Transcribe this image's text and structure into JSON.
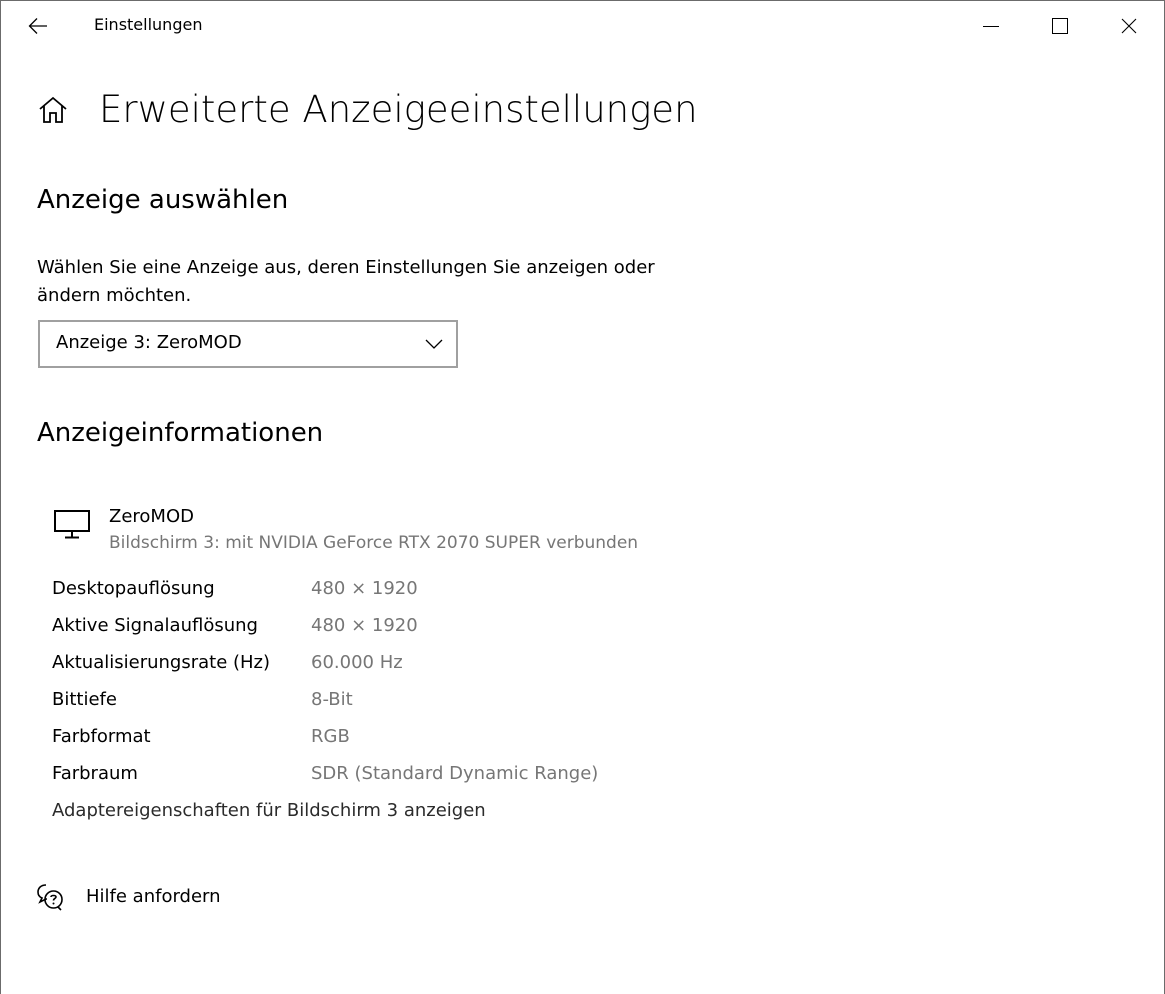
{
  "titlebar": {
    "app_title": "Einstellungen",
    "back_icon": "arrow-left-icon",
    "controls": [
      "minimize-icon",
      "maximize-icon",
      "close-icon"
    ]
  },
  "header": {
    "home_icon": "home-icon",
    "title": "Erweiterte Anzeigeeinstellungen"
  },
  "select_display": {
    "heading": "Anzeige auswählen",
    "description": "Wählen Sie eine Anzeige aus, deren Einstellungen Sie anzeigen oder ändern möchten.",
    "dropdown_value": "Anzeige 3: ZeroMOD"
  },
  "display_info": {
    "heading": "Anzeigeinformationen",
    "monitor_icon": "monitor-icon",
    "name": "ZeroMOD",
    "subtitle": "Bildschirm 3: mit NVIDIA GeForce RTX 2070 SUPER verbunden",
    "rows": [
      {
        "label": "Desktopauflösung",
        "value": "480 × 1920"
      },
      {
        "label": "Aktive Signalauflösung",
        "value": "480 × 1920"
      },
      {
        "label": "Aktualisierungsrate (Hz)",
        "value": "60.000 Hz"
      },
      {
        "label": "Bittiefe",
        "value": "8-Bit"
      },
      {
        "label": "Farbformat",
        "value": "RGB"
      },
      {
        "label": "Farbraum",
        "value": "SDR (Standard Dynamic Range)"
      }
    ],
    "adapter_link": "Adaptereigenschaften für Bildschirm 3 anzeigen"
  },
  "help": {
    "icon": "help-chat-icon",
    "label": "Hilfe anfordern"
  },
  "colors": {
    "text": "#000000",
    "secondary_text": "#767676",
    "dropdown_border": "#a0a0a0",
    "background": "#ffffff"
  }
}
